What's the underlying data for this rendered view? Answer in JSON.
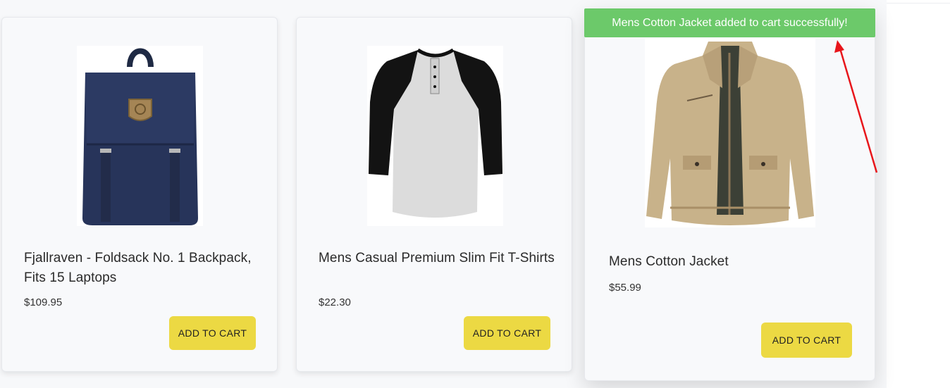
{
  "toast": {
    "message": "Mens Cotton Jacket added to cart successfully!"
  },
  "products": [
    {
      "title": "Fjallraven - Foldsack No. 1 Backpack, Fits 15 Laptops",
      "price": "$109.95",
      "button": "ADD TO CART",
      "image": "backpack-image"
    },
    {
      "title": "Mens Casual Premium Slim Fit T-Shirts",
      "price": "$22.30",
      "button": "ADD TO CART",
      "image": "raglan-tshirt-image"
    },
    {
      "title": "Mens Cotton Jacket",
      "price": "$55.99",
      "button": "ADD TO CART",
      "image": "cotton-jacket-image"
    }
  ],
  "colors": {
    "toast_bg": "#6cc96a",
    "button_bg": "#ecd943",
    "annotation_arrow": "#e8161b"
  }
}
